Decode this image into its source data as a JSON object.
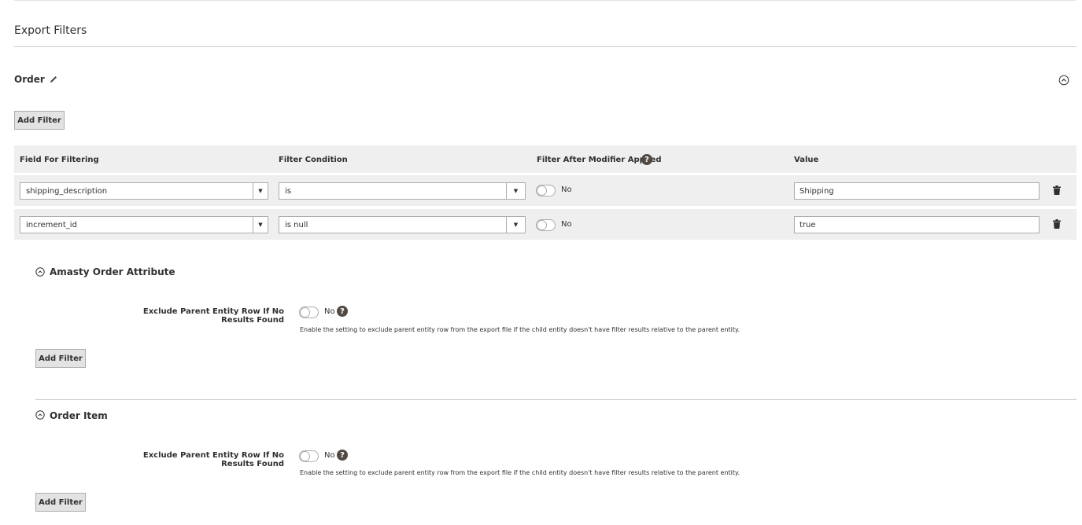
{
  "page": {
    "section_title": "Export Filters"
  },
  "entity": {
    "title": "Order",
    "add_filter_label": "Add Filter"
  },
  "table": {
    "headers": {
      "field": "Field For Filtering",
      "condition": "Filter Condition",
      "after_modifier": "Filter After Modifier Applied",
      "value": "Value"
    },
    "help_glyph": "?",
    "rows": [
      {
        "field": "shipping_description",
        "condition": "is",
        "after_modifier": "No",
        "value": "Shipping"
      },
      {
        "field": "increment_id",
        "condition": "is null",
        "after_modifier": "No",
        "value": "true"
      }
    ]
  },
  "subsections": [
    {
      "title": "Amasty Order Attribute",
      "exclude_label": "Exclude Parent Entity Row If No Results Found",
      "toggle_label": "No",
      "note": "Enable the setting to exclude parent entity row from the export file if the child entity doesn't have filter results relative to the parent entity.",
      "add_filter_label": "Add Filter"
    },
    {
      "title": "Order Item",
      "exclude_label": "Exclude Parent Entity Row If No Results Found",
      "toggle_label": "No",
      "note": "Enable the setting to exclude parent entity row from the export file if the child entity doesn't have filter results relative to the parent entity.",
      "add_filter_label": "Add Filter"
    }
  ],
  "icons": {
    "edit": "pencil-icon",
    "collapse": "circle-chevron-up-icon",
    "delete": "trash-icon",
    "help": "question-icon",
    "dropdown": "triangle-down-icon"
  },
  "colors": {
    "header_bg": "#efefef",
    "button_bg": "#e3e3e3",
    "help_bg": "#514943",
    "text": "#303030"
  }
}
